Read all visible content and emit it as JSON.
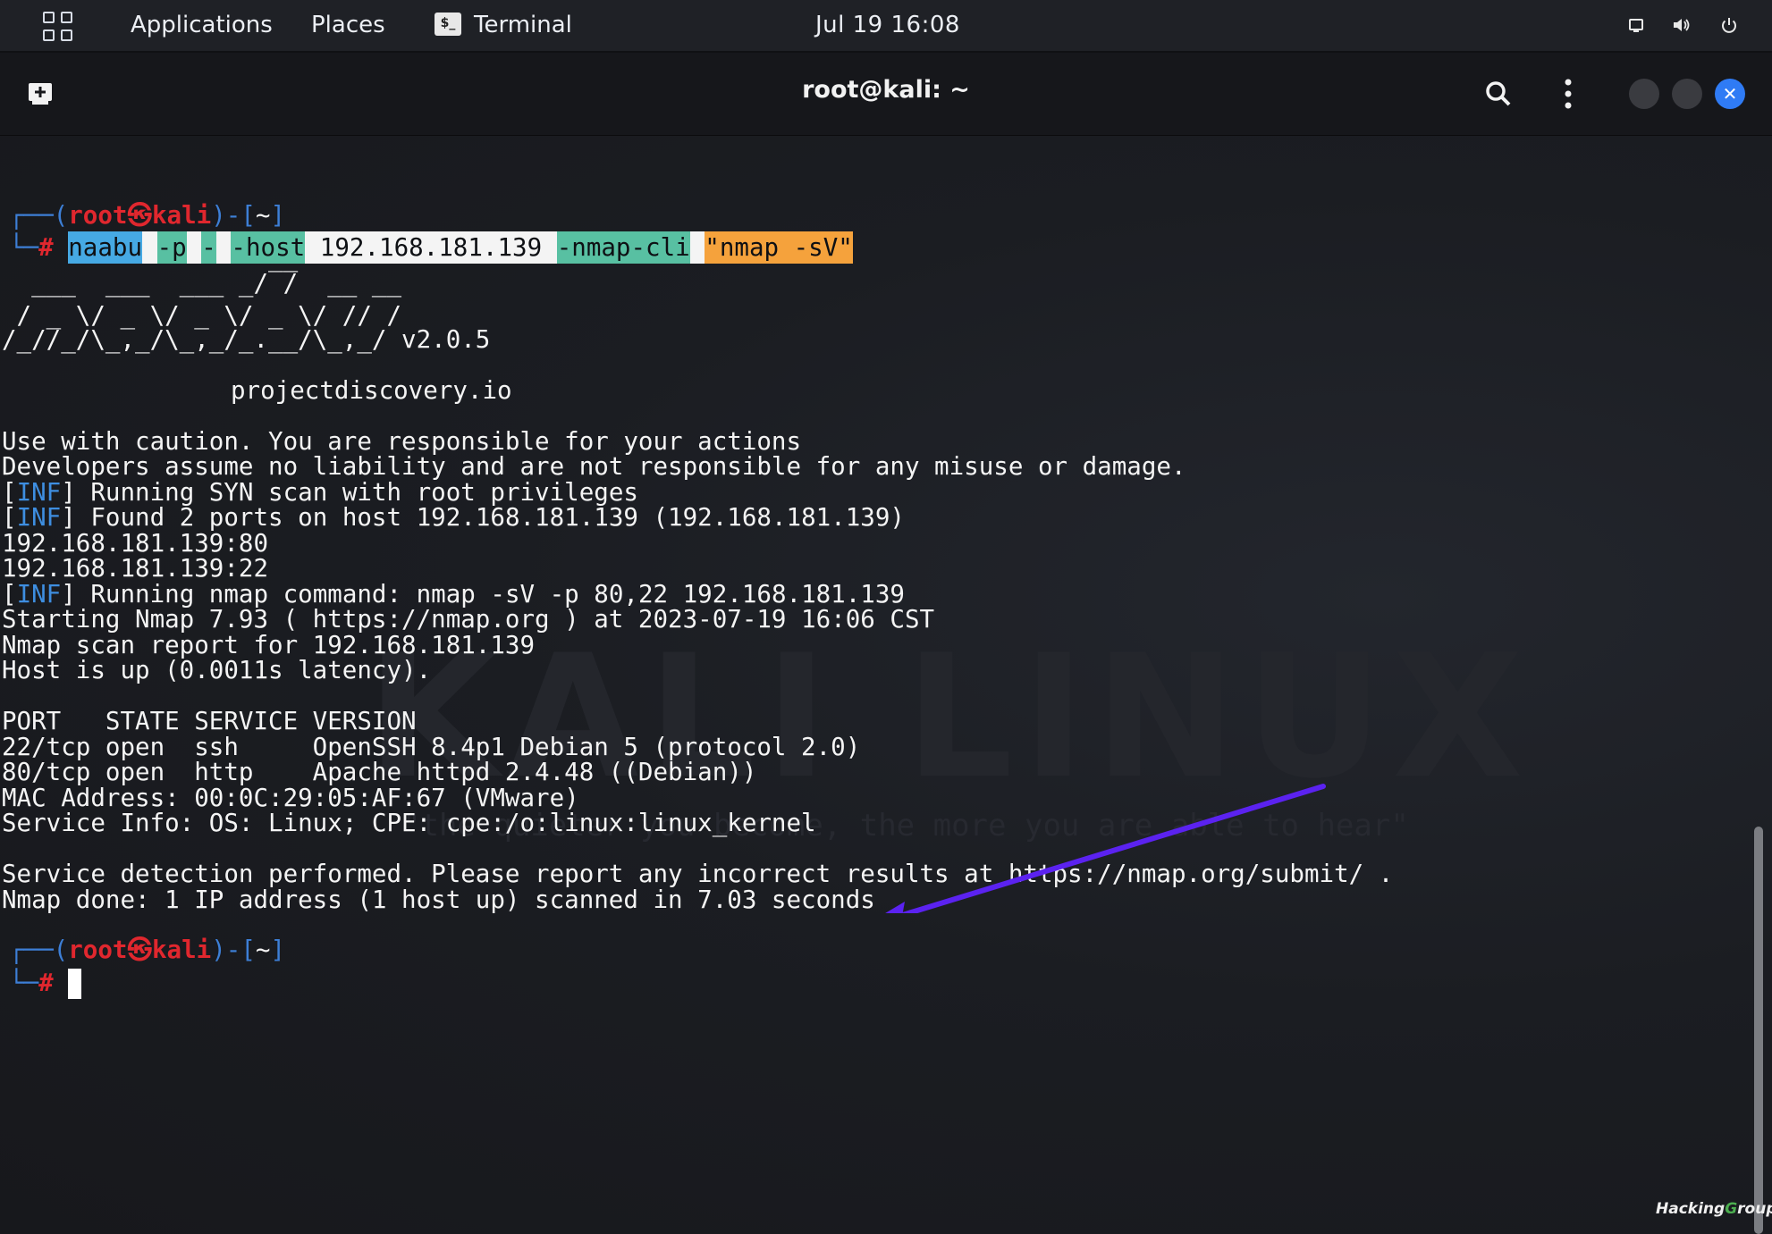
{
  "topbar": {
    "applications": "Applications",
    "places": "Places",
    "terminal": "Terminal",
    "term_icon_text": "$_",
    "date": "Jul 19",
    "time": "16:08",
    "icons": [
      "activities-grid-icon",
      "display-icon",
      "volume-icon",
      "power-icon"
    ]
  },
  "window": {
    "title": "root@kali: ~",
    "icons": [
      "new-tab-icon",
      "search-icon",
      "kebab-menu-icon",
      "minimize-icon",
      "maximize-icon",
      "close-icon"
    ],
    "close_glyph": "✕"
  },
  "prompt": {
    "open": "┌──(",
    "user": "root",
    "skull": "㉿",
    "host": "kali",
    "mid": ")-[",
    "dir": "~",
    "close": "]",
    "corner": "└─",
    "hash": "#"
  },
  "command": {
    "segments": [
      "naabu",
      "-p",
      "-",
      "-host",
      "192.168.181.139",
      "-nmap-cli",
      "\"nmap -sV\""
    ]
  },
  "banner": {
    "art": [
      "                  __",
      "  ___  ___  ___ _/ /  __ __",
      " / _ \\/ _ \\/ _ \\/ _ \\/ // /",
      "/_//_/\\_,_/\\_,_/_.__/\\_,_/ v2.0.5"
    ],
    "site": "projectdiscovery.io"
  },
  "output": [
    "Use with caution. You are responsible for your actions",
    "Developers assume no liability and are not responsible for any misuse or damage."
  ],
  "inf_tag": "INF",
  "inf_lines": [
    "Running SYN scan with root privileges",
    "Found 2 ports on host 192.168.181.139 (192.168.181.139)",
    "Running nmap command: nmap -sV -p 80,22 192.168.181.139"
  ],
  "ports": [
    "192.168.181.139:80",
    "192.168.181.139:22"
  ],
  "nmap": [
    "Starting Nmap 7.93 ( https://nmap.org ) at 2023-07-19 16:06 CST",
    "Nmap scan report for 192.168.181.139",
    "Host is up (0.0011s latency).",
    "",
    "PORT   STATE SERVICE VERSION",
    "22/tcp open  ssh     OpenSSH 8.4p1 Debian 5 (protocol 2.0)",
    "80/tcp open  http    Apache httpd 2.4.48 ((Debian))",
    "MAC Address: 00:0C:29:05:AF:67 (VMware)",
    "Service Info: OS: Linux; CPE: cpe:/o:linux:linux_kernel",
    "",
    "Service detection performed. Please report any incorrect results at https://nmap.org/submit/ .",
    "Nmap done: 1 IP address (1 host up) scanned in 7.03 seconds"
  ],
  "background": {
    "watermark": "KALI LINUX",
    "tagline": "\"the quieter you become, the more you are able to hear\""
  },
  "brand": {
    "part1": "Hacking",
    "g": "G",
    "part2": "roup"
  },
  "colors": {
    "arrow": "#5b22f0",
    "prompt_red": "#e0272e",
    "prompt_blue": "#3d7fd6"
  }
}
